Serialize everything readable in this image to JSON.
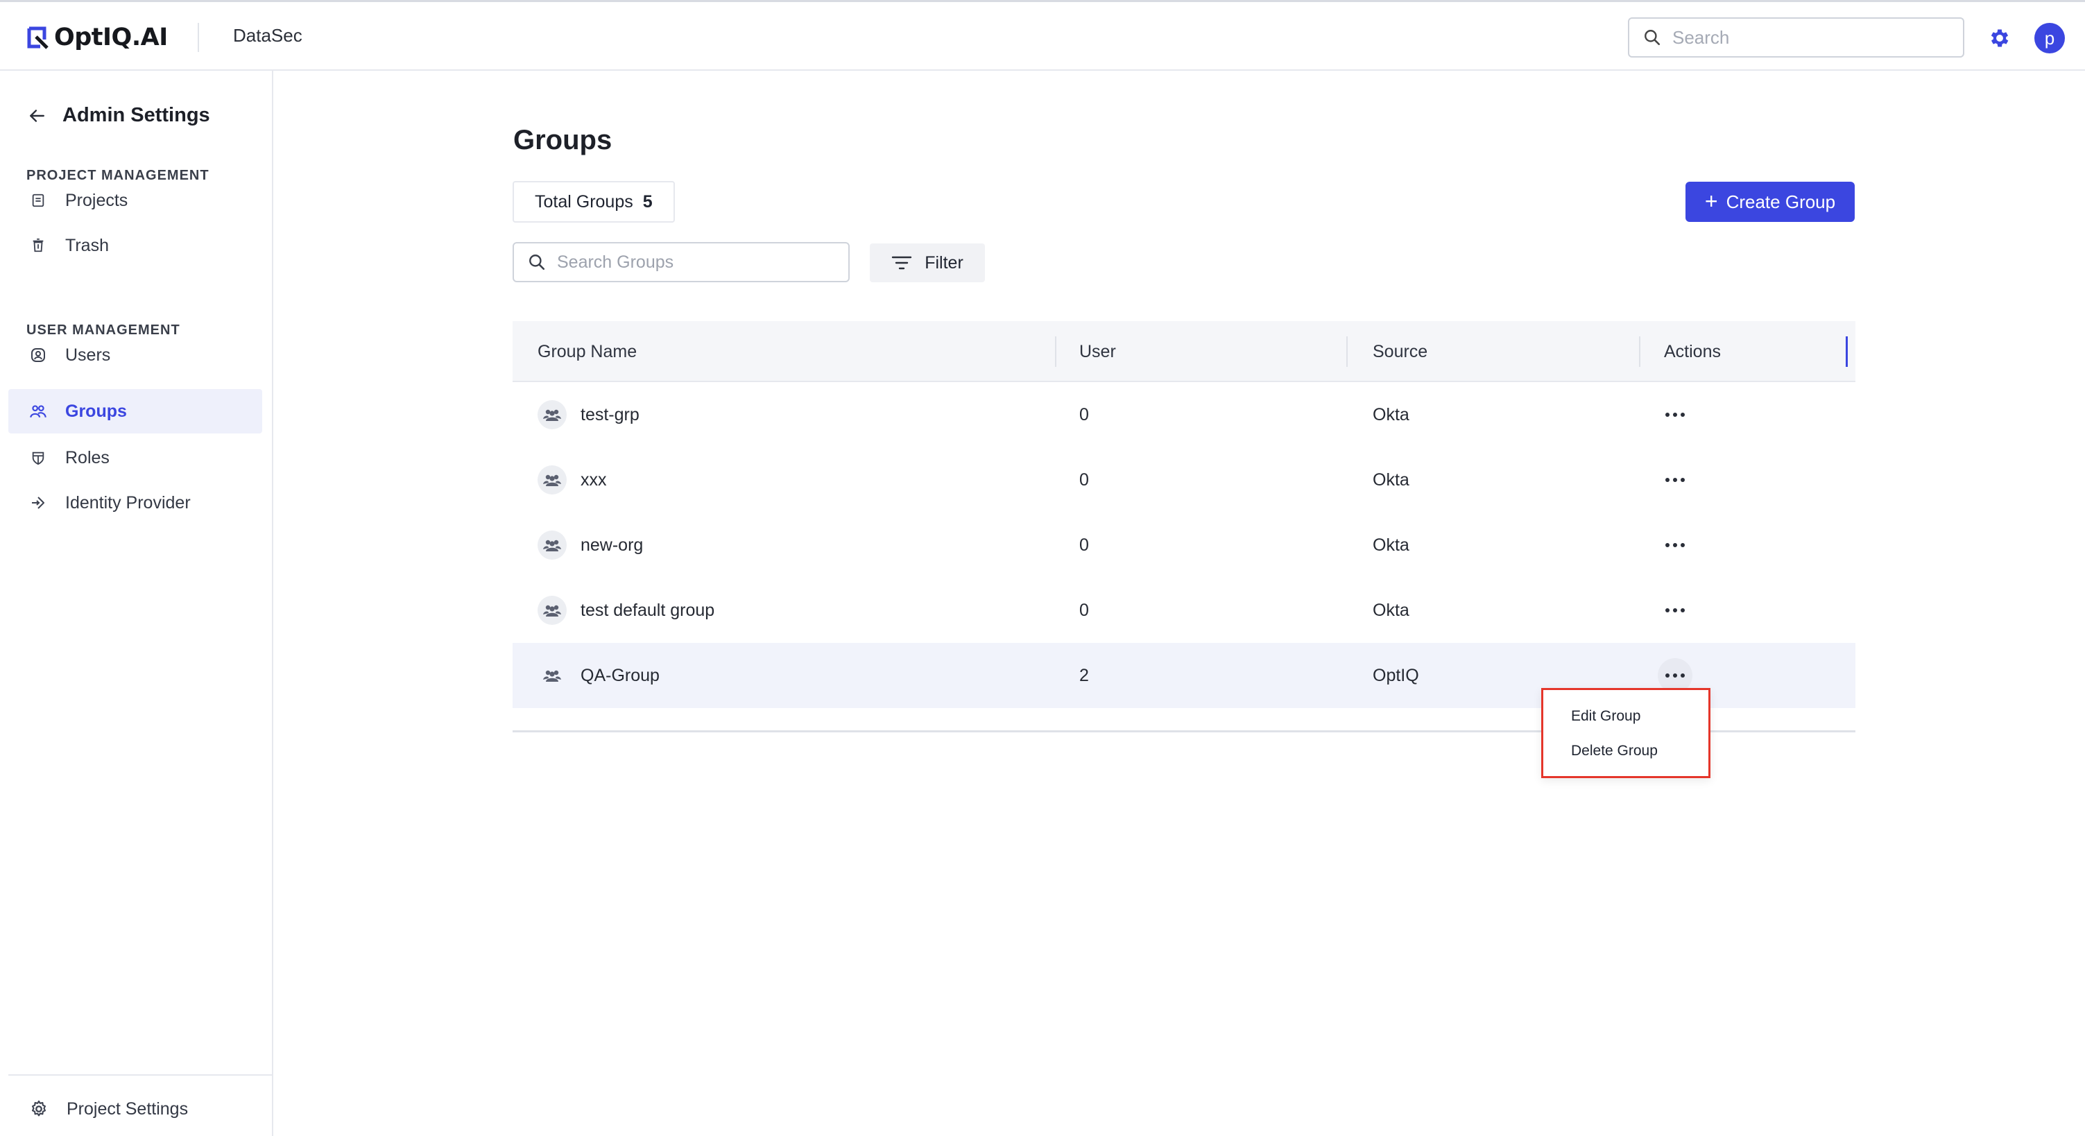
{
  "header": {
    "logo_text": "OptIQ.AI",
    "project_name": "DataSec",
    "search_placeholder": "Search",
    "avatar_initial": "p"
  },
  "sidebar": {
    "title": "Admin Settings",
    "sections": [
      {
        "label": "PROJECT MANAGEMENT",
        "items": [
          {
            "label": "Projects",
            "icon": "document-icon"
          },
          {
            "label": "Trash",
            "icon": "trash-icon"
          }
        ]
      },
      {
        "label": "USER MANAGEMENT",
        "items": [
          {
            "label": "Users",
            "icon": "user-icon"
          },
          {
            "label": "Groups",
            "icon": "groups-icon",
            "active": true
          },
          {
            "label": "Roles",
            "icon": "shield-icon"
          },
          {
            "label": "Identity Provider",
            "icon": "login-arrow-icon"
          }
        ]
      }
    ],
    "footer_label": "Project Settings"
  },
  "main": {
    "title": "Groups",
    "total_label": "Total Groups",
    "total_count": "5",
    "create_button": "Create Group",
    "search_placeholder": "Search Groups",
    "filter_label": "Filter",
    "columns": [
      "Group Name",
      "User",
      "Source",
      "Actions"
    ],
    "rows": [
      {
        "name": "test-grp",
        "users": "0",
        "source": "Okta"
      },
      {
        "name": "xxx",
        "users": "0",
        "source": "Okta"
      },
      {
        "name": "new-org",
        "users": "0",
        "source": "Okta"
      },
      {
        "name": "test default group",
        "users": "0",
        "source": "Okta"
      },
      {
        "name": "QA-Group",
        "users": "2",
        "source": "OptIQ"
      }
    ],
    "context_menu": [
      "Edit Group",
      "Delete Group"
    ]
  },
  "colors": {
    "accent": "#3b46e0",
    "menu_highlight_border": "#e5362b"
  }
}
